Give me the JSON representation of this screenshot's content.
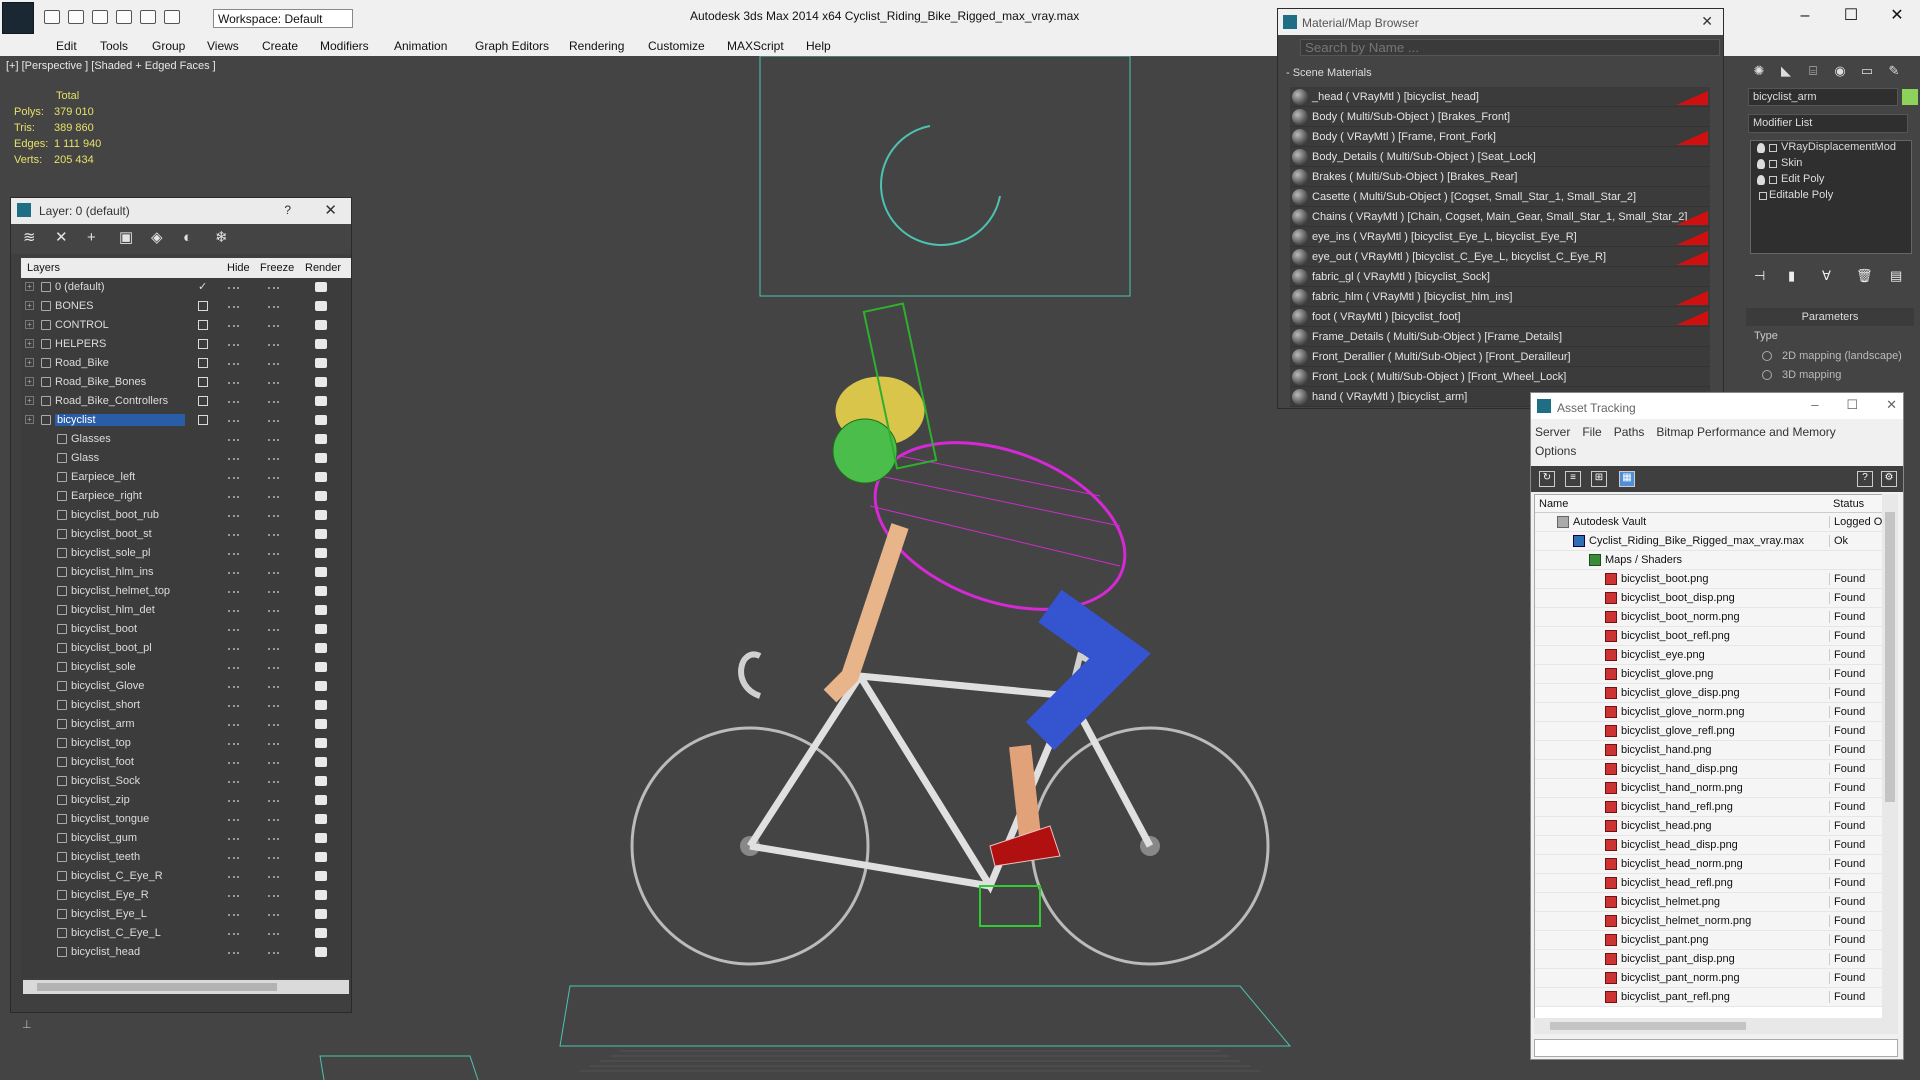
{
  "titlebar": {
    "workspace": "Workspace: Default",
    "title": "Autodesk 3ds Max  2014 x64      Cyclist_Riding_Bike_Rigged_max_vray.max"
  },
  "menus": [
    "Edit",
    "Tools",
    "Group",
    "Views",
    "Create",
    "Modifiers",
    "Animation",
    "Graph Editors",
    "Rendering",
    "Customize",
    "MAXScript",
    "Help"
  ],
  "viewport": {
    "label": "[+] [Perspective ] [Shaded + Edged Faces ]",
    "stats": {
      "header": "Total",
      "rows": [
        {
          "label": "Polys:",
          "value": "379 010"
        },
        {
          "label": "Tris:",
          "value": "389 860"
        },
        {
          "label": "Edges:",
          "value": "1 111 940"
        },
        {
          "label": "Verts:",
          "value": "205 434"
        }
      ]
    }
  },
  "layer_panel": {
    "title": "Layer: 0 (default)",
    "help": "?",
    "columns": {
      "layers": "Layers",
      "hide": "Hide",
      "freeze": "Freeze",
      "render": "Render"
    },
    "rows": [
      {
        "name": "0 (default)",
        "level": 0,
        "checked": true
      },
      {
        "name": "BONES",
        "level": 0,
        "box": true
      },
      {
        "name": "CONTROL",
        "level": 0,
        "box": true
      },
      {
        "name": "HELPERS",
        "level": 0,
        "box": true
      },
      {
        "name": "Road_Bike",
        "level": 0,
        "box": true
      },
      {
        "name": "Road_Bike_Bones",
        "level": 0,
        "box": true
      },
      {
        "name": "Road_Bike_Controllers",
        "level": 0,
        "box": true
      },
      {
        "name": "bicyclist",
        "level": 0,
        "box": true,
        "selected": true
      },
      {
        "name": "Glasses",
        "level": 1
      },
      {
        "name": "Glass",
        "level": 1
      },
      {
        "name": "Earpiece_left",
        "level": 1
      },
      {
        "name": "Earpiece_right",
        "level": 1
      },
      {
        "name": "bicyclist_boot_rub",
        "level": 1
      },
      {
        "name": "bicyclist_boot_st",
        "level": 1
      },
      {
        "name": "bicyclist_sole_pl",
        "level": 1
      },
      {
        "name": "bicyclist_hlm_ins",
        "level": 1
      },
      {
        "name": "bicyclist_helmet_top",
        "level": 1
      },
      {
        "name": "bicyclist_hlm_det",
        "level": 1
      },
      {
        "name": "bicyclist_boot",
        "level": 1
      },
      {
        "name": "bicyclist_boot_pl",
        "level": 1
      },
      {
        "name": "bicyclist_sole",
        "level": 1
      },
      {
        "name": "bicyclist_Glove",
        "level": 1
      },
      {
        "name": "bicyclist_short",
        "level": 1
      },
      {
        "name": "bicyclist_arm",
        "level": 1
      },
      {
        "name": "bicyclist_top",
        "level": 1
      },
      {
        "name": "bicyclist_foot",
        "level": 1
      },
      {
        "name": "bicyclist_Sock",
        "level": 1
      },
      {
        "name": "bicyclist_zip",
        "level": 1
      },
      {
        "name": "bicyclist_tongue",
        "level": 1
      },
      {
        "name": "bicyclist_gum",
        "level": 1
      },
      {
        "name": "bicyclist_teeth",
        "level": 1
      },
      {
        "name": "bicyclist_C_Eye_R",
        "level": 1
      },
      {
        "name": "bicyclist_Eye_R",
        "level": 1
      },
      {
        "name": "bicyclist_Eye_L",
        "level": 1
      },
      {
        "name": "bicyclist_C_Eye_L",
        "level": 1
      },
      {
        "name": "bicyclist_head",
        "level": 1
      }
    ]
  },
  "material_browser": {
    "title": "Material/Map Browser",
    "search_placeholder": "Search by Name ...",
    "group": "- Scene Materials",
    "rows": [
      {
        "text": "_head  ( VRayMtl ) [bicyclist_head]",
        "flag": true
      },
      {
        "text": "Body  ( Multi/Sub-Object ) [Brakes_Front]",
        "flag": false
      },
      {
        "text": "Body  ( VRayMtl ) [Frame, Front_Fork]",
        "flag": true
      },
      {
        "text": "Body_Details  ( Multi/Sub-Object ) [Seat_Lock]",
        "flag": false
      },
      {
        "text": "Brakes  ( Multi/Sub-Object ) [Brakes_Rear]",
        "flag": false
      },
      {
        "text": "Casette  ( Multi/Sub-Object ) [Cogset, Small_Star_1, Small_Star_2]",
        "flag": false
      },
      {
        "text": "Chains  ( VRayMtl ) [Chain, Cogset, Main_Gear, Small_Star_1, Small_Star_2]",
        "flag": true
      },
      {
        "text": "eye_ins  ( VRayMtl ) [bicyclist_Eye_L, bicyclist_Eye_R]",
        "flag": true
      },
      {
        "text": "eye_out  ( VRayMtl ) [bicyclist_C_Eye_L, bicyclist_C_Eye_R]",
        "flag": true
      },
      {
        "text": "fabric_gl  ( VRayMtl ) [bicyclist_Sock]",
        "flag": false
      },
      {
        "text": "fabric_hlm  ( VRayMtl ) [bicyclist_hlm_ins]",
        "flag": true
      },
      {
        "text": "foot  ( VRayMtl ) [bicyclist_foot]",
        "flag": true
      },
      {
        "text": "Frame_Details  ( Multi/Sub-Object ) [Frame_Details]",
        "flag": false
      },
      {
        "text": "Front_Derallier  ( Multi/Sub-Object ) [Front_Derailleur]",
        "flag": false
      },
      {
        "text": "Front_Lock  ( Multi/Sub-Object ) [Front_Wheel_Lock]",
        "flag": false
      },
      {
        "text": "hand  ( VRayMtl ) [bicyclist_arm]",
        "flag": true
      }
    ]
  },
  "command_panel": {
    "object_name": "bicyclist_arm",
    "object_color": "#8dd25a",
    "modifier_list": "Modifier List",
    "stack": [
      "VRayDisplacementMod",
      "Skin",
      "Edit Poly",
      "Editable Poly"
    ],
    "params_header": "Parameters",
    "type_label": "Type",
    "radio1": "2D mapping (landscape)",
    "radio2": "3D mapping"
  },
  "asset_tracking": {
    "title": "Asset Tracking",
    "menu": [
      "Server",
      "File",
      "Paths",
      "Bitmap Performance and Memory",
      "Options"
    ],
    "columns": {
      "name": "Name",
      "status": "Status"
    },
    "rows": [
      {
        "name": "Autodesk Vault",
        "status": "Logged Out",
        "kind": "vault",
        "indent": 1
      },
      {
        "name": "Cyclist_Riding_Bike_Rigged_max_vray.max",
        "status": "Ok",
        "kind": "file",
        "indent": 2
      },
      {
        "name": "Maps / Shaders",
        "status": "",
        "kind": "maps",
        "indent": 3
      },
      {
        "name": "bicyclist_boot.png",
        "status": "Found",
        "kind": "png",
        "indent": 4
      },
      {
        "name": "bicyclist_boot_disp.png",
        "status": "Found",
        "kind": "png",
        "indent": 4
      },
      {
        "name": "bicyclist_boot_norm.png",
        "status": "Found",
        "kind": "png",
        "indent": 4
      },
      {
        "name": "bicyclist_boot_refl.png",
        "status": "Found",
        "kind": "png",
        "indent": 4
      },
      {
        "name": "bicyclist_eye.png",
        "status": "Found",
        "kind": "png",
        "indent": 4
      },
      {
        "name": "bicyclist_glove.png",
        "status": "Found",
        "kind": "png",
        "indent": 4
      },
      {
        "name": "bicyclist_glove_disp.png",
        "status": "Found",
        "kind": "png",
        "indent": 4
      },
      {
        "name": "bicyclist_glove_norm.png",
        "status": "Found",
        "kind": "png",
        "indent": 4
      },
      {
        "name": "bicyclist_glove_refl.png",
        "status": "Found",
        "kind": "png",
        "indent": 4
      },
      {
        "name": "bicyclist_hand.png",
        "status": "Found",
        "kind": "png",
        "indent": 4
      },
      {
        "name": "bicyclist_hand_disp.png",
        "status": "Found",
        "kind": "png",
        "indent": 4
      },
      {
        "name": "bicyclist_hand_norm.png",
        "status": "Found",
        "kind": "png",
        "indent": 4
      },
      {
        "name": "bicyclist_hand_refl.png",
        "status": "Found",
        "kind": "png",
        "indent": 4
      },
      {
        "name": "bicyclist_head.png",
        "status": "Found",
        "kind": "png",
        "indent": 4
      },
      {
        "name": "bicyclist_head_disp.png",
        "status": "Found",
        "kind": "png",
        "indent": 4
      },
      {
        "name": "bicyclist_head_norm.png",
        "status": "Found",
        "kind": "png",
        "indent": 4
      },
      {
        "name": "bicyclist_head_refl.png",
        "status": "Found",
        "kind": "png",
        "indent": 4
      },
      {
        "name": "bicyclist_helmet.png",
        "status": "Found",
        "kind": "png",
        "indent": 4
      },
      {
        "name": "bicyclist_helmet_norm.png",
        "status": "Found",
        "kind": "png",
        "indent": 4
      },
      {
        "name": "bicyclist_pant.png",
        "status": "Found",
        "kind": "png",
        "indent": 4
      },
      {
        "name": "bicyclist_pant_disp.png",
        "status": "Found",
        "kind": "png",
        "indent": 4
      },
      {
        "name": "bicyclist_pant_norm.png",
        "status": "Found",
        "kind": "png",
        "indent": 4
      },
      {
        "name": "bicyclist_pant_refl.png",
        "status": "Found",
        "kind": "png",
        "indent": 4
      }
    ]
  }
}
